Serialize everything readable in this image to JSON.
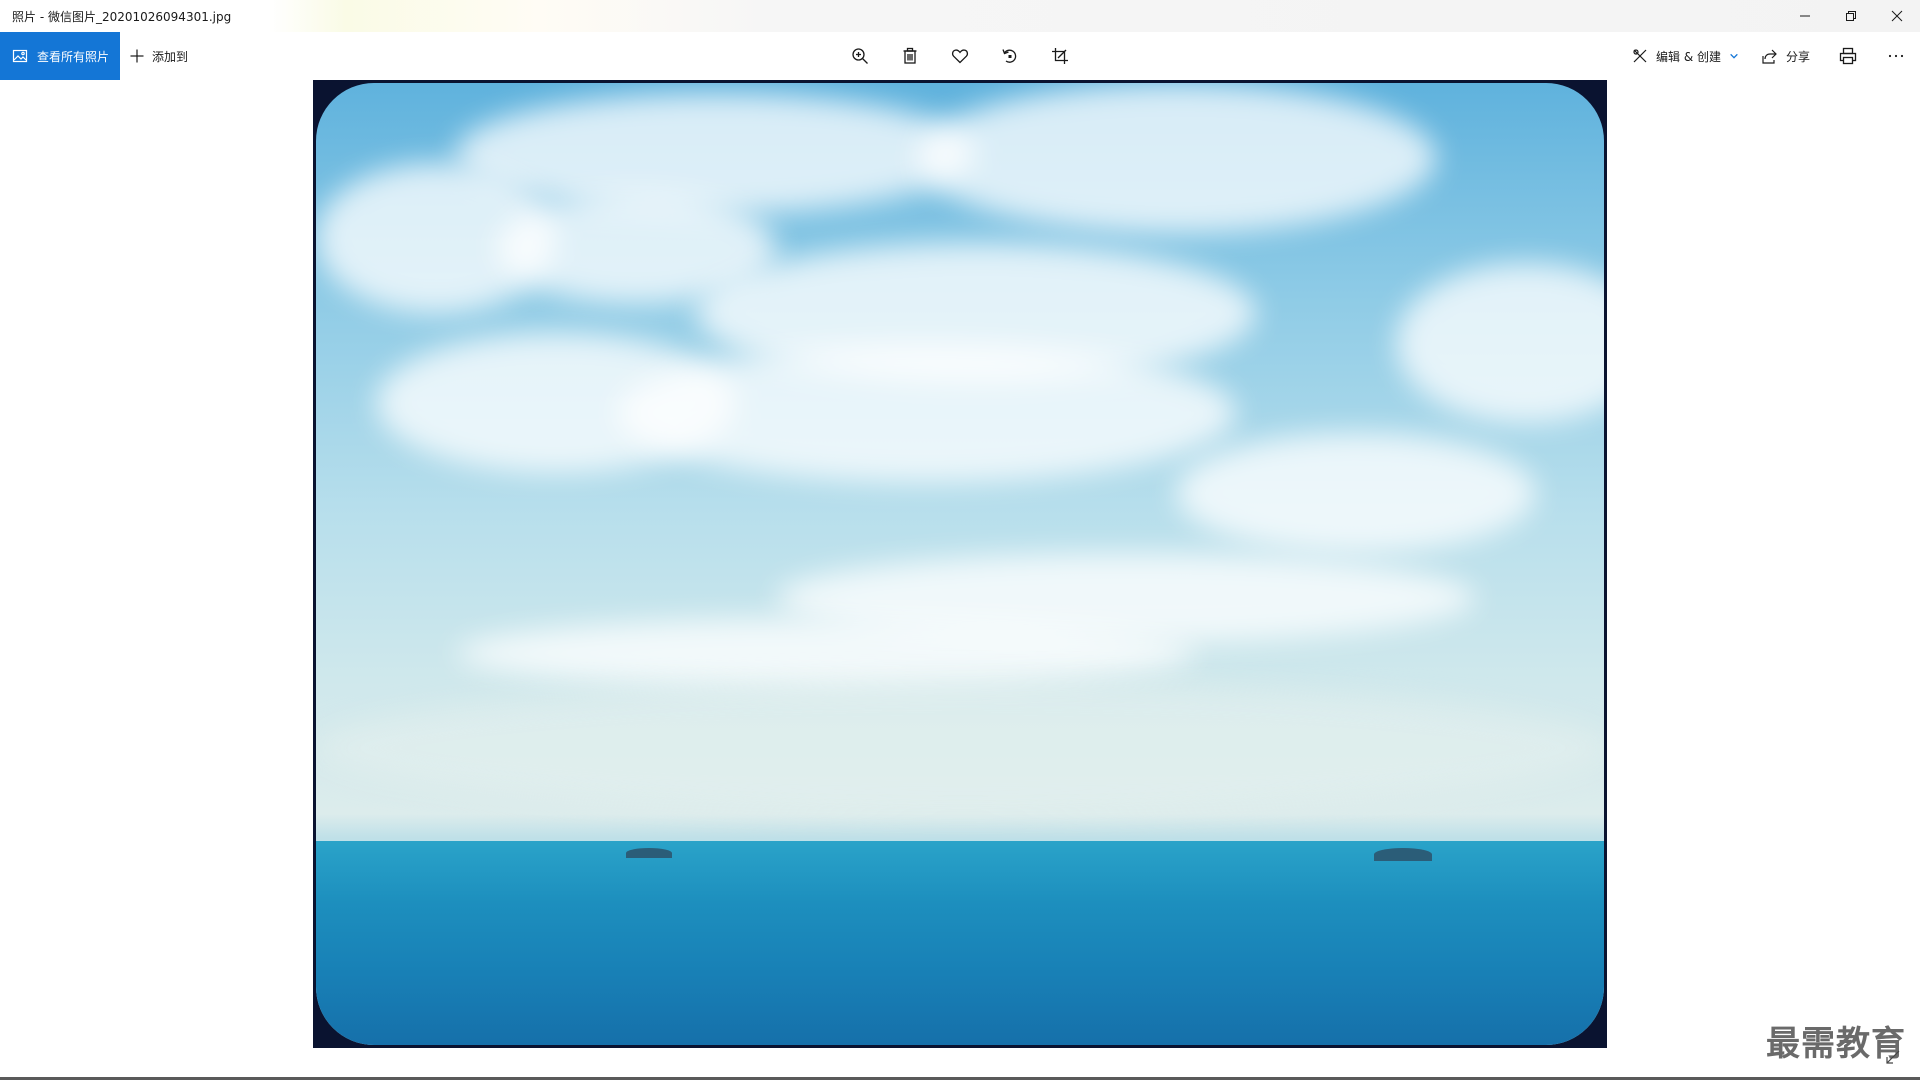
{
  "window": {
    "title": "照片 - 微信图片_20201026094301.jpg",
    "controls": {
      "minimize": "minimize-icon",
      "restore": "restore-icon",
      "close": "close-icon"
    }
  },
  "toolbar": {
    "view_all_label": "查看所有照片",
    "add_to_label": "添加到",
    "tools": [
      "zoom-in-icon",
      "delete-icon",
      "favorite-icon",
      "rotate-icon",
      "crop-icon"
    ],
    "edit_create_label": "编辑 & 创建",
    "share_label": "分享",
    "print_icon": "print-icon",
    "more_icon": "more-icon"
  },
  "watermark": {
    "text": "最需教育"
  },
  "colors": {
    "accent": "#1476d6",
    "frame": "#0a1330",
    "sky": "#8ecbe6",
    "sea": "#1d8fbe"
  }
}
